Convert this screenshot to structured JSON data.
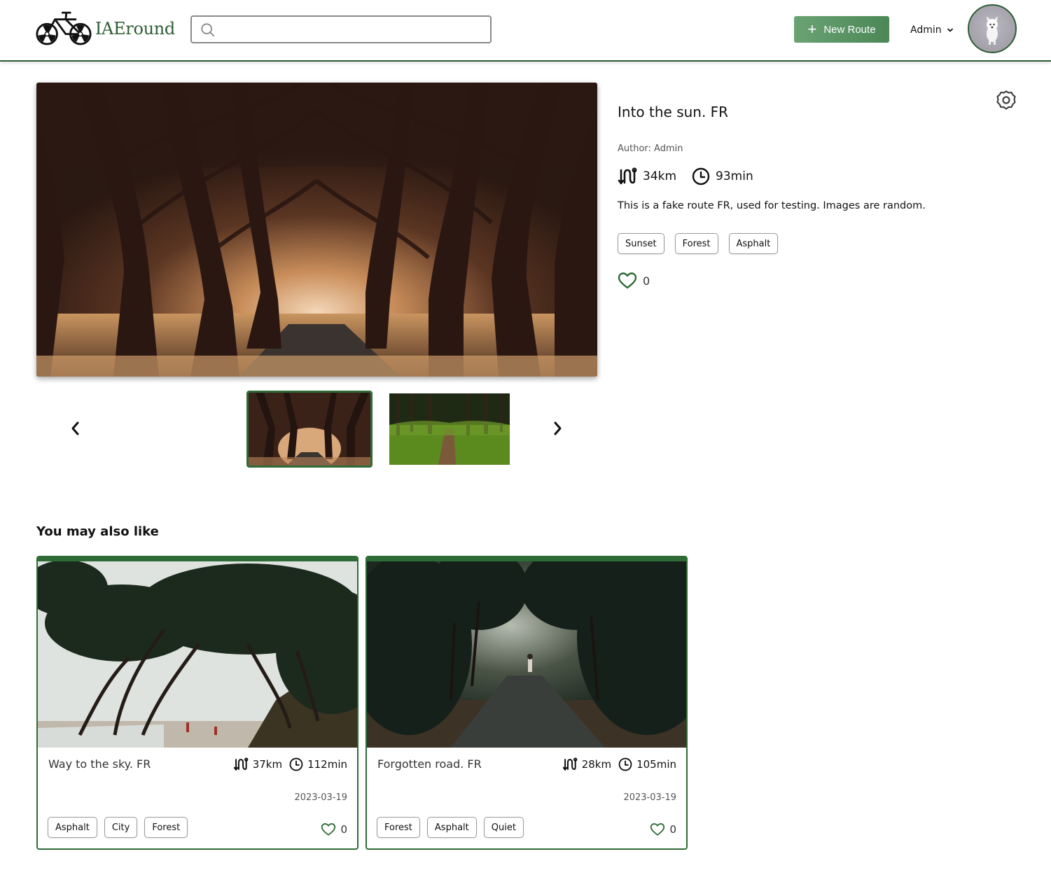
{
  "header": {
    "logo_text": "IAEround",
    "search_placeholder": "",
    "new_route_label": "New Route",
    "user_menu_label": "Admin"
  },
  "gallery": {
    "images": [
      "tree-tunnel-road",
      "forest-path-moss"
    ],
    "selected_index": 0
  },
  "route": {
    "title": "Into the sun. FR",
    "author": "Author: Admin",
    "distance": "34km",
    "duration": "93min",
    "description": "This is a fake route FR, used for testing. Images are random.",
    "tags": [
      "Sunset",
      "Forest",
      "Asphalt"
    ],
    "likes": "0"
  },
  "suggestions": {
    "title": "You may also like",
    "cards": [
      {
        "title": "Way to the sky. FR",
        "distance": "37km",
        "duration": "112min",
        "date": "2023-03-19",
        "tags": [
          "Asphalt",
          "City",
          "Forest"
        ],
        "likes": "0"
      },
      {
        "title": "Forgotten road. FR",
        "distance": "28km",
        "duration": "105min",
        "date": "2023-03-19",
        "tags": [
          "Forest",
          "Asphalt",
          "Quiet"
        ],
        "likes": "0"
      }
    ]
  },
  "colors": {
    "brand_green": "#2f5d35",
    "button_green": "#5a9465",
    "card_border": "#2f6b36"
  }
}
